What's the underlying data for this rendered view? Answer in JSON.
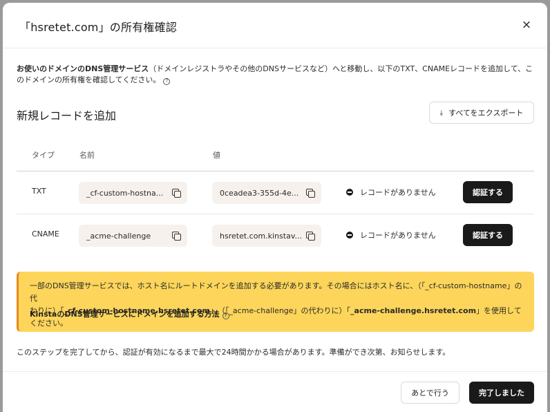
{
  "modal": {
    "title": "「hsretet.com」の所有権確認",
    "close_label": "×"
  },
  "intro": {
    "bold": "お使いのドメインのDNS管理サービス",
    "text": "（ドメインレジストラやその他のDNSサービスなど）へと移動し、以下のTXT、CNAMEレコードを追加して、このドメインの所有権を確認してください。",
    "help_icon": "?"
  },
  "records_section": {
    "title": "新規レコードを追加",
    "export_label": "すべてをエクスポート",
    "export_icon": "⤓"
  },
  "table": {
    "headers": {
      "type": "タイプ",
      "name": "名前",
      "value": "値"
    },
    "rows": [
      {
        "type": "TXT",
        "name": "_cf-custom-hostna...",
        "value": "0ceadea3-355d-4e...",
        "status": "レコードがありません",
        "action": "認証する"
      },
      {
        "type": "CNAME",
        "name": "_acme-challenge",
        "value": "hsretet.com.kinstav...",
        "status": "レコードがありません",
        "action": "認証する"
      }
    ]
  },
  "warning": {
    "p1": "一部のDNS管理サービスでは、ホスト名にルートドメインを追加する必要があります。その場合にはホスト名に、（「_cf-custom-hostname」の代",
    "p2a": "わりに）「",
    "p2b": "_cf-custom-hostname.hsretet.com",
    "p2c": "」、（「_acme-challenge」の代わりに）「",
    "p2d": "_acme-challenge.hsretet.com",
    "p2e": "」を使用してください。",
    "link": "KinstaのDNS管理サービスにドメインを追加する方法",
    "link_icon": "?"
  },
  "footer": {
    "note": "このステップを完了してから、認証が有効になるまで最大で24時間かかる場合があります。準備ができ次第、お知らせします。",
    "later_label": "あとで行う",
    "done_label": "完了しました"
  },
  "colors": {
    "warning_bg": "#fcd55a",
    "warning_accent": "#e8891a",
    "primary_button": "#1a1a1a",
    "field_bg": "#f6f1ec"
  }
}
